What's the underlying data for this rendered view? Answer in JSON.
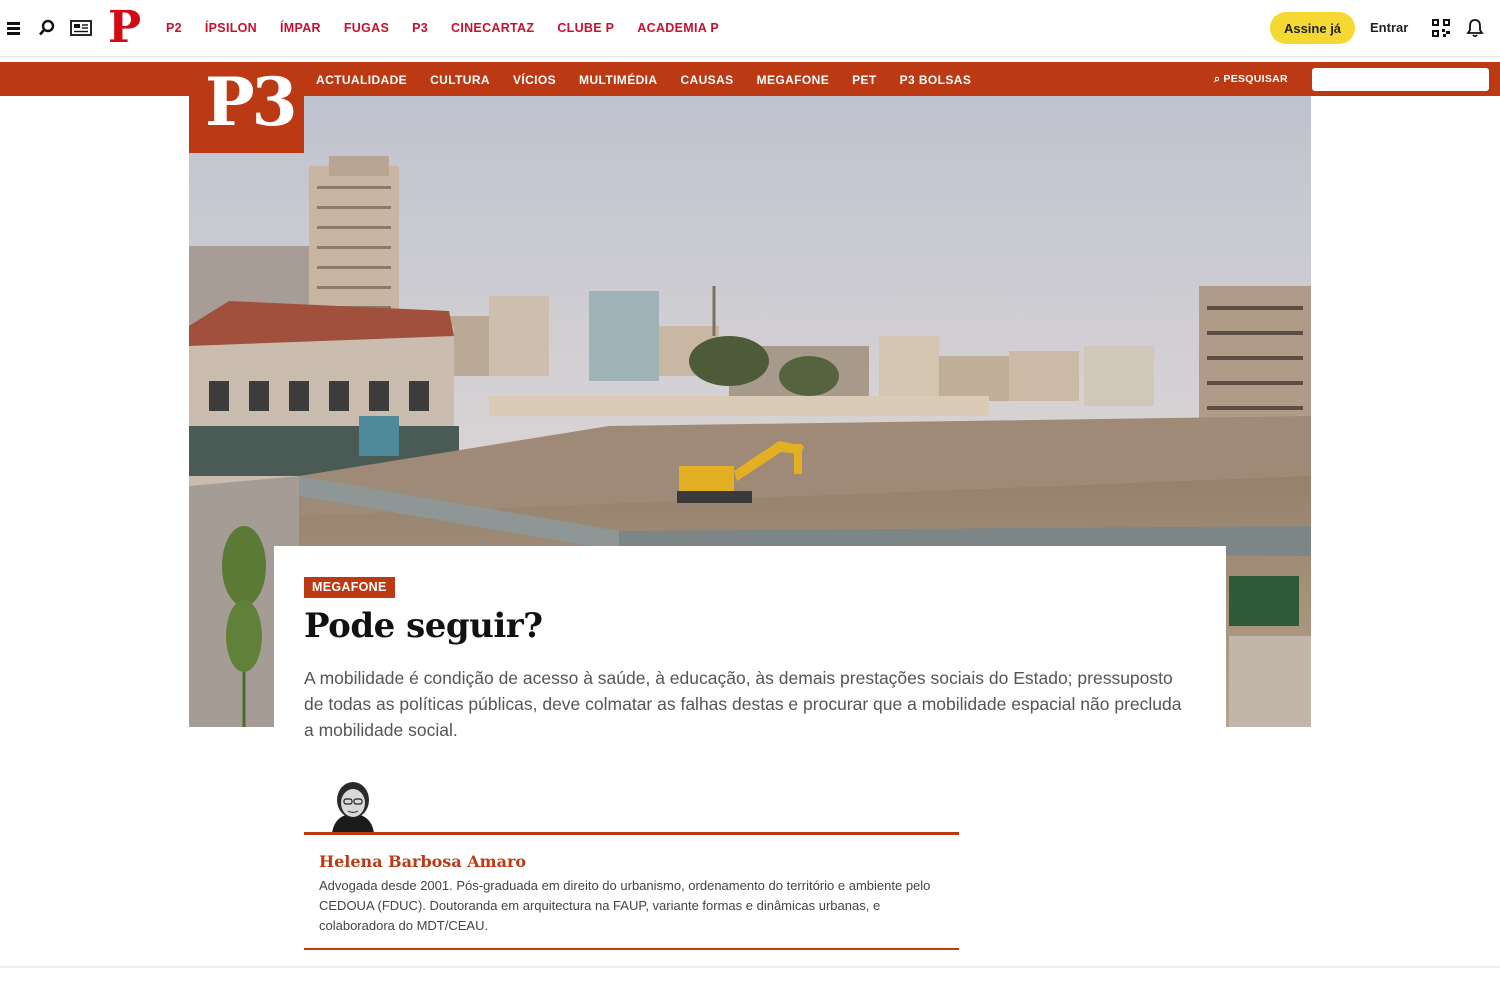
{
  "topbar": {
    "logo": "P",
    "nav": [
      "P2",
      "ÍPSILON",
      "ÍMPAR",
      "FUGAS",
      "P3",
      "CINECARTAZ",
      "CLUBE P",
      "ACADEMIA P"
    ],
    "subscribe_label": "Assine já",
    "login_label": "Entrar",
    "icons": [
      "menu-icon",
      "search-icon",
      "newspaper-icon",
      "qr-code-icon",
      "bell-icon"
    ]
  },
  "p3bar": {
    "logo": "P3",
    "nav": [
      "ACTUALIDADE",
      "CULTURA",
      "VÍCIOS",
      "MULTIMÉDIA",
      "CAUSAS",
      "MEGAFONE",
      "PET",
      "P3 BOLSAS"
    ],
    "search_label": "⌕ PESQUISAR",
    "search_placeholder": ""
  },
  "article": {
    "section": "MEGAFONE",
    "title": "Pode seguir?",
    "lead": "A mobilidade é condição de acesso à saúde, à educação, às demais prestações sociais do Estado; pressuposto de todas as políticas públicas, deve colmatar as falhas destas e procurar que a mobilidade espacial não precluda a mobilidade social."
  },
  "author": {
    "name": "Helena Barbosa Amaro",
    "bio": "Advogada desde 2001. Pós-graduada em direito do urbanismo, ordenamento do território e ambiente pelo CEDOUA (FDUC). Doutoranda em arquitectura na FAUP, variante formas e dinâmicas urbanas, e colaboradora do MDT/CEAU."
  },
  "colors": {
    "brand_red": "#d20a11",
    "p3_orange": "#bb3a14",
    "subscribe_yellow": "#f5d932"
  }
}
